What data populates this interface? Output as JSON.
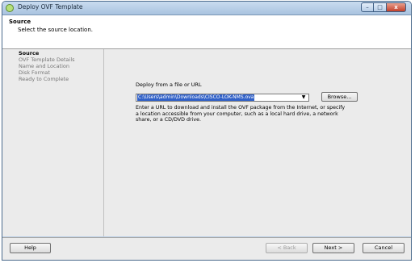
{
  "window": {
    "title": "Deploy OVF Template",
    "controls": {
      "minimize": "–",
      "maximize": "□",
      "close": "x"
    }
  },
  "header": {
    "title": "Source",
    "subtitle": "Select the source location."
  },
  "nav": {
    "items": [
      {
        "label": "Source",
        "active": true
      },
      {
        "label": "OVF Template Details",
        "active": false
      },
      {
        "label": "Name and Location",
        "active": false
      },
      {
        "label": "Disk Format",
        "active": false
      },
      {
        "label": "Ready to Complete",
        "active": false
      }
    ]
  },
  "source": {
    "label": "Deploy from a file or URL",
    "value": "C:\\Users\\admin\\Downloads\\CISCO-LOK-NMS.ova",
    "browse_label": "Browse...",
    "help_text": "Enter a URL to download and install the OVF package from the Internet, or specify a location accessible from your computer, such as a local hard drive, a network share, or a CD/DVD drive."
  },
  "footer": {
    "help_label": "Help",
    "back_label": "< Back",
    "next_label": "Next >",
    "cancel_label": "Cancel"
  }
}
